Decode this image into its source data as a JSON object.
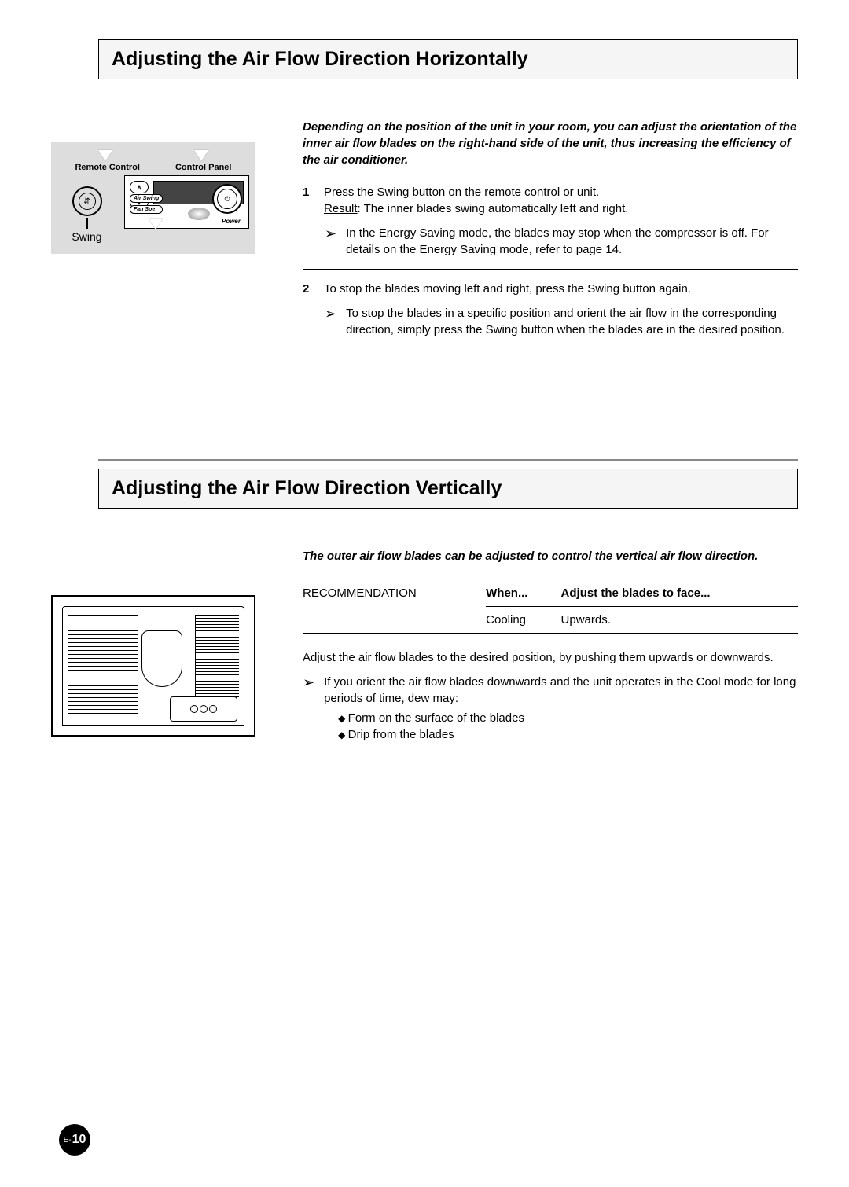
{
  "section1": {
    "title": "Adjusting the Air Flow Direction Horizontally",
    "illus": {
      "remote_label": "Remote Control",
      "panel_label": "Control Panel",
      "swing_label": "Swing",
      "air_swing_btn": "Air Swing",
      "fan_speed_btn": "Fan Spe",
      "power_label": "Power"
    },
    "intro": "Depending on the position of the unit in your room, you can adjust the orientation of the inner air flow blades on the right-hand side of the unit, thus increasing the efficiency of the air conditioner.",
    "steps": [
      {
        "num": "1",
        "text": "Press the Swing button on the remote control or unit.",
        "result_label": "Result",
        "result_text": ":   The inner blades swing automatically left and right.",
        "note": "In the Energy Saving mode, the blades may stop when the compressor is off. For details on the Energy Saving mode, refer to page 14."
      },
      {
        "num": "2",
        "text": "To stop the blades moving left and right, press the Swing button again.",
        "note": "To stop the blades in a specific position and orient the air flow in the corresponding direction, simply press the Swing button when the blades are in the desired position."
      }
    ]
  },
  "section2": {
    "title": "Adjusting the Air Flow Direction Vertically",
    "intro": "The outer air flow blades can be adjusted to control the vertical air flow direction.",
    "rec_label": "RECOMMENDATION",
    "table": {
      "h1": "When...",
      "h2": "Adjust the blades to face...",
      "r1c1": "Cooling",
      "r1c2": "Upwards."
    },
    "body_text": "Adjust the air flow blades to the desired position, by pushing them upwards or downwards.",
    "note": "If you orient the air flow blades downwards and the unit operates in the Cool mode for long periods of time, dew may:",
    "bullets": [
      "Form on the surface of the blades",
      "Drip from the blades"
    ]
  },
  "page_number": {
    "prefix": "E-",
    "num": "10"
  }
}
